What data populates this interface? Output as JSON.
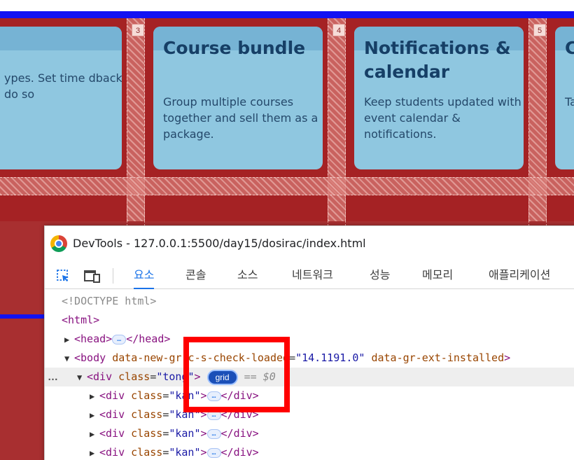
{
  "grid_line_numbers": [
    "3",
    "4",
    "5"
  ],
  "cards": [
    {
      "title": "",
      "text": "ypes. Set time dback, and do so"
    },
    {
      "title": "Course bundle",
      "text": "Group multiple courses together and sell them as a package."
    },
    {
      "title": "Notifications & calendar",
      "text": "Keep students updated with event calendar & notifications."
    },
    {
      "title": "C",
      "text": "Ta co sc co"
    }
  ],
  "devtools": {
    "title": "DevTools - 127.0.0.1:5500/day15/dosirac/index.html",
    "tabs": [
      "요소",
      "콘솔",
      "소스",
      "네트워크",
      "성능",
      "메모리",
      "애플리케이션"
    ],
    "active_tab": "요소",
    "code": {
      "doctype": "<!DOCTYPE html>",
      "html_open": "<html>",
      "head_open": "<head>",
      "head_close": "</head>",
      "body_tag": "<body",
      "body_attr1": "data-new-gr-c-s-check-loaded",
      "body_val1": "\"14.1191.0\"",
      "body_attr2": "data-gr-ext-installed",
      "body_close": ">",
      "div_open": "<div",
      "class_attr": "class",
      "tong_val": "\"tong\"",
      "gt": ">",
      "badge": "grid",
      "dollar": "== $0",
      "kan_val": "\"kan\"",
      "div_close": "</div>",
      "ellipsis": "…",
      "row_dots": "…"
    }
  },
  "colors": {
    "grid_background": "#a52224",
    "card_fill": "#8fc7e0",
    "card_title": "#163f66",
    "highlight_border": "#ff0000",
    "blue_line": "#1212f2"
  }
}
